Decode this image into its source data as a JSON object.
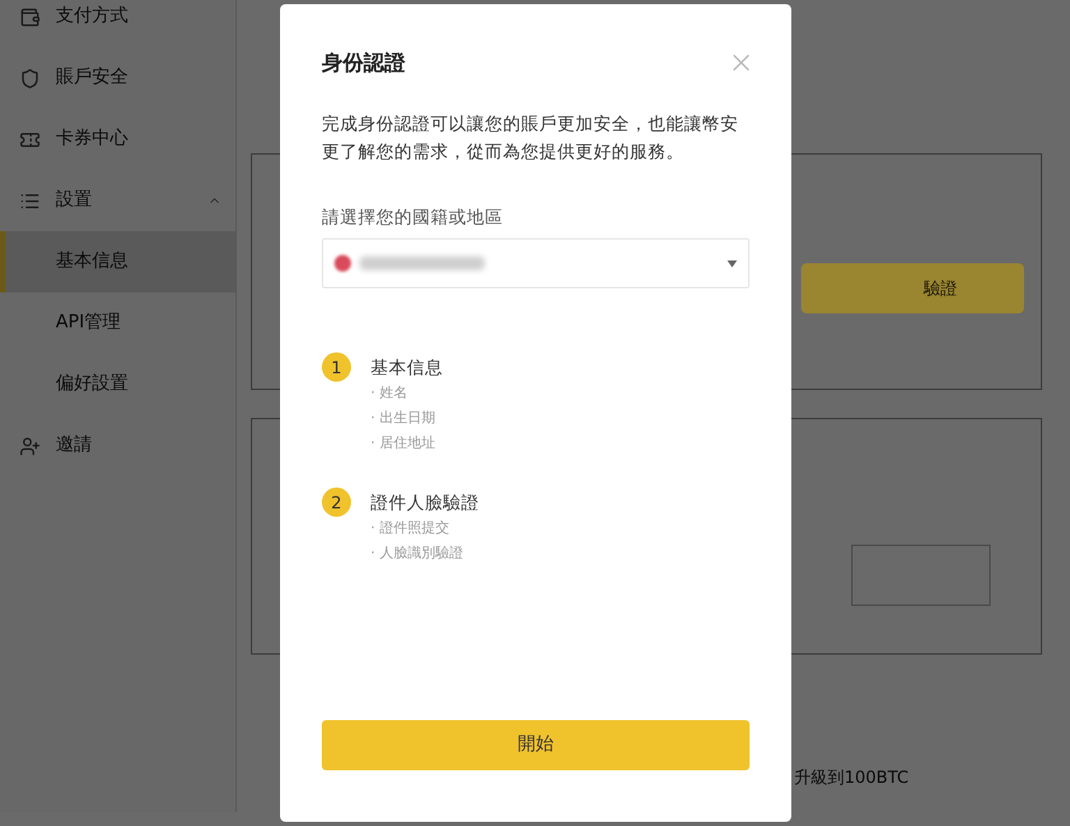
{
  "sidebar": {
    "items": [
      {
        "label": "支付方式",
        "kind": "top",
        "selected": false
      },
      {
        "label": "賬戶安全",
        "kind": "top",
        "selected": false
      },
      {
        "label": "卡券中心",
        "kind": "top",
        "selected": false
      },
      {
        "label": "設置",
        "kind": "group",
        "selected": false,
        "expanded": true
      },
      {
        "label": "基本信息",
        "kind": "sub",
        "selected": true
      },
      {
        "label": "API管理",
        "kind": "sub",
        "selected": false
      },
      {
        "label": "偏好設置",
        "kind": "sub",
        "selected": false
      },
      {
        "label": "邀請",
        "kind": "top",
        "selected": false
      }
    ]
  },
  "background": {
    "verify_button": "驗證",
    "upgrade_text": "升級到100BTC"
  },
  "modal": {
    "title": "身份認證",
    "description": "完成身份認證可以讓您的賬戶更加安全，也能讓幣安更了解您的需求，從而為您提供更好的服務。",
    "country_label": "請選擇您的國籍或地區",
    "steps": [
      {
        "number": "1",
        "title": "基本信息",
        "items": [
          "· 姓名",
          "· 出生日期",
          "· 居住地址"
        ]
      },
      {
        "number": "2",
        "title": "證件人臉驗證",
        "items": [
          "· 證件照提交",
          "· 人臉識別驗證"
        ]
      }
    ],
    "start_button": "開始"
  }
}
